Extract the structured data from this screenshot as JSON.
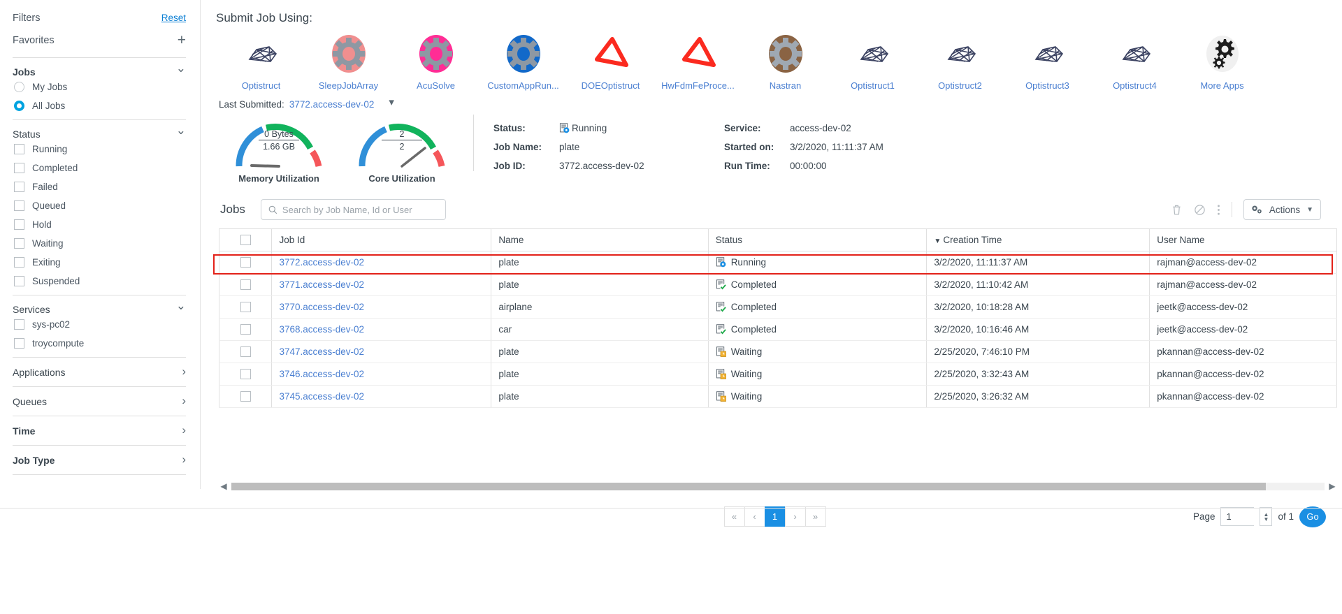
{
  "sidebar": {
    "title": "Filters",
    "reset": "Reset",
    "favorites": "Favorites",
    "add_icon": "+",
    "jobs_section": {
      "label": "Jobs",
      "options": [
        {
          "label": "My Jobs",
          "selected": false
        },
        {
          "label": "All Jobs",
          "selected": true
        }
      ]
    },
    "status_section": {
      "label": "Status",
      "options": [
        {
          "label": "Running",
          "checked": false
        },
        {
          "label": "Completed",
          "checked": false
        },
        {
          "label": "Failed",
          "checked": false
        },
        {
          "label": "Queued",
          "checked": false
        },
        {
          "label": "Hold",
          "checked": false
        },
        {
          "label": "Waiting",
          "checked": false
        },
        {
          "label": "Exiting",
          "checked": false
        },
        {
          "label": "Suspended",
          "checked": false
        }
      ]
    },
    "services_section": {
      "label": "Services",
      "options": [
        {
          "label": "sys-pc02",
          "checked": false
        },
        {
          "label": "troycompute",
          "checked": false
        }
      ]
    },
    "collapsed_sections": [
      {
        "label": "Applications",
        "bold": false
      },
      {
        "label": "Queues",
        "bold": false
      },
      {
        "label": "Time",
        "bold": true
      },
      {
        "label": "Job Type",
        "bold": true
      }
    ]
  },
  "main": {
    "submit_title": "Submit Job Using:",
    "apps": [
      {
        "label": "Optistruct",
        "icon": "mesh-icon"
      },
      {
        "label": "SleepJobArray",
        "icon": "gear-icon",
        "color": "#f08f8f"
      },
      {
        "label": "AcuSolve",
        "icon": "gear-icon",
        "color": "#ff2d95"
      },
      {
        "label": "CustomAppRun...",
        "icon": "gear-icon",
        "color": "#1269c9"
      },
      {
        "label": "DOEOptistruct",
        "icon": "triangle-icon",
        "color": "#fb2a1f"
      },
      {
        "label": "HwFdmFeProce...",
        "icon": "triangle-icon",
        "color": "#fb2a1f"
      },
      {
        "label": "Nastran",
        "icon": "gear-icon",
        "color": "#8a6343"
      },
      {
        "label": "Optistruct1",
        "icon": "mesh-icon"
      },
      {
        "label": "Optistruct2",
        "icon": "mesh-icon"
      },
      {
        "label": "Optistruct3",
        "icon": "mesh-icon"
      },
      {
        "label": "Optistruct4",
        "icon": "mesh-icon"
      },
      {
        "label": "More Apps",
        "icon": "gears-icon"
      }
    ],
    "last_submitted": {
      "label": "Last Submitted:",
      "value": "3772.access-dev-02",
      "chevron": "chevron-down-icon"
    },
    "gauges": [
      {
        "caption": "Memory Utilization",
        "top_value": "0 Bytes",
        "bottom_value": "1.66 GB",
        "needle_deg": -88
      },
      {
        "caption": "Core Utilization",
        "top_value": "2",
        "bottom_value": "2",
        "needle_deg": 52
      }
    ],
    "details_left": [
      {
        "key": "Status:",
        "value": "Running",
        "icon": "job-running-icon"
      },
      {
        "key": "Job Name:",
        "value": "plate"
      },
      {
        "key": "Job ID:",
        "value": "3772.access-dev-02"
      }
    ],
    "details_right": [
      {
        "key": "Service:",
        "value": "access-dev-02"
      },
      {
        "key": "Started on:",
        "value": "3/2/2020, 11:11:37 AM"
      },
      {
        "key": "Run Time:",
        "value": "00:00:00"
      }
    ],
    "jobs_label": "Jobs",
    "search_placeholder": "Search by Job Name, Id or User",
    "toolbar_icons": [
      "trash-icon",
      "cancel-icon",
      "more-vertical-icon"
    ],
    "actions_label": "Actions",
    "table": {
      "columns": [
        "Job Id",
        "Name",
        "Status",
        "Creation Time",
        "User Name"
      ],
      "sorted_column": "Creation Time",
      "sort_direction": "desc",
      "rows": [
        {
          "job_id": "3772.access-dev-02",
          "name": "plate",
          "status": "Running",
          "status_icon": "job-running-icon",
          "creation_time": "3/2/2020, 11:11:37 AM",
          "user": "rajman@access-dev-02",
          "highlighted": true
        },
        {
          "job_id": "3771.access-dev-02",
          "name": "plate",
          "status": "Completed",
          "status_icon": "job-completed-icon",
          "creation_time": "3/2/2020, 11:10:42 AM",
          "user": "rajman@access-dev-02",
          "highlighted": false
        },
        {
          "job_id": "3770.access-dev-02",
          "name": "airplane",
          "status": "Completed",
          "status_icon": "job-completed-icon",
          "creation_time": "3/2/2020, 10:18:28 AM",
          "user": "jeetk@access-dev-02",
          "highlighted": false
        },
        {
          "job_id": "3768.access-dev-02",
          "name": "car",
          "status": "Completed",
          "status_icon": "job-completed-icon",
          "creation_time": "3/2/2020, 10:16:46 AM",
          "user": "jeetk@access-dev-02",
          "highlighted": false
        },
        {
          "job_id": "3747.access-dev-02",
          "name": "plate",
          "status": "Waiting",
          "status_icon": "job-waiting-icon",
          "creation_time": "2/25/2020, 7:46:10 PM",
          "user": "pkannan@access-dev-02",
          "highlighted": false
        },
        {
          "job_id": "3746.access-dev-02",
          "name": "plate",
          "status": "Waiting",
          "status_icon": "job-waiting-icon",
          "creation_time": "2/25/2020, 3:32:43 AM",
          "user": "pkannan@access-dev-02",
          "highlighted": false
        },
        {
          "job_id": "3745.access-dev-02",
          "name": "plate",
          "status": "Waiting",
          "status_icon": "job-waiting-icon",
          "creation_time": "2/25/2020, 3:26:32 AM",
          "user": "pkannan@access-dev-02",
          "highlighted": false
        }
      ]
    },
    "pagination": {
      "first": "«",
      "prev": "‹",
      "current": "1",
      "next": "›",
      "last": "»",
      "page_label": "Page",
      "page_value": "1",
      "of_label": "of 1",
      "go_label": "Go"
    }
  },
  "colors": {
    "accent": "#1a8fe3",
    "link": "#4a7fd1",
    "highlight": "#e32119",
    "gauge_blue": "#2f8fd8",
    "gauge_green": "#11b35c",
    "gauge_red": "#f5565a"
  }
}
